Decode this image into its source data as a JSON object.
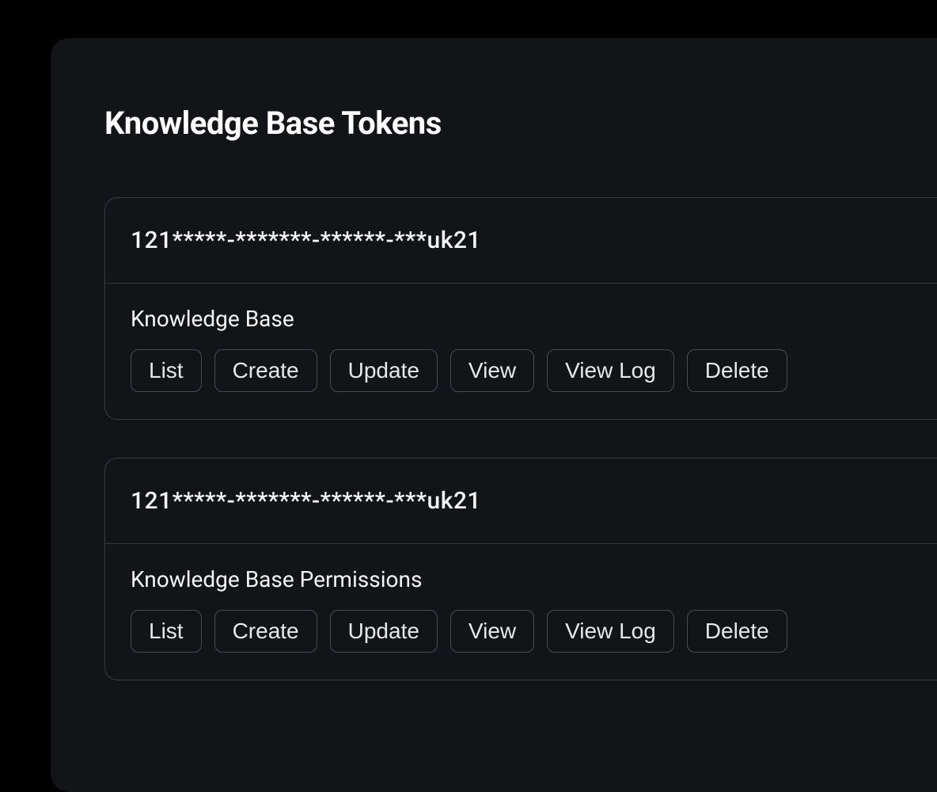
{
  "page": {
    "title": "Knowledge Base Tokens"
  },
  "tokens": [
    {
      "masked_id": "121*****-*******-******-***uk21",
      "section_label": "Knowledge Base",
      "permissions": [
        "List",
        "Create",
        "Update",
        "View",
        "View Log",
        "Delete"
      ]
    },
    {
      "masked_id": "121*****-*******-******-***uk21",
      "section_label": "Knowledge Base Permissions",
      "permissions": [
        "List",
        "Create",
        "Update",
        "View",
        "View Log",
        "Delete"
      ]
    }
  ]
}
